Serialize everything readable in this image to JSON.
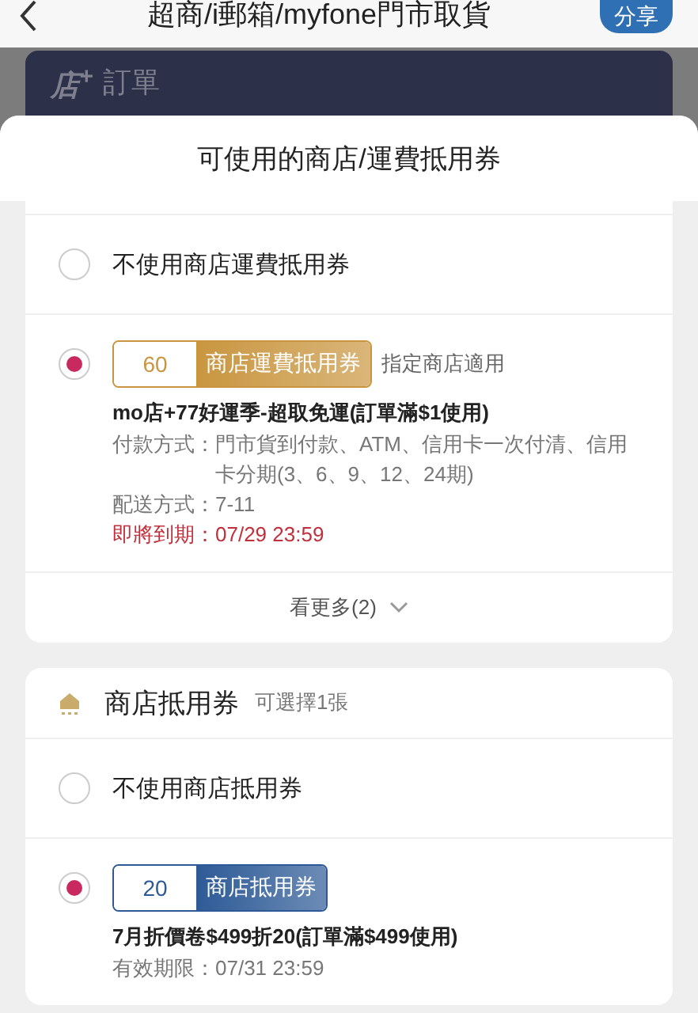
{
  "nav": {
    "title": "超商/i郵箱/myfone門市取貨",
    "share_button": "分享"
  },
  "background_card": {
    "logo": "店$^{+}$",
    "title": "訂單"
  },
  "sheet": {
    "title": "可使用的商店/運費抵用券"
  },
  "sections": [
    {
      "options": [
        {
          "kind": "none",
          "label": "不使用商店運費抵用券",
          "selected": false
        },
        {
          "kind": "coupon",
          "selected": true,
          "amount": "60",
          "type_label": "商店運費抵用券",
          "color": "#c9963f",
          "scope": "指定商店適用",
          "name": "mo店+77好運季-超取免運(訂單滿$1使用)",
          "details": [
            {
              "label": "付款方式：",
              "value": "門市貨到付款、ATM、信用卡一次付清、信用卡分期(3、6、9、12、24期)",
              "urgent": false
            },
            {
              "label": "配送方式：",
              "value": "7-11",
              "urgent": false
            },
            {
              "label": "即將到期：",
              "value": "07/29 23:59",
              "urgent": true
            }
          ]
        }
      ],
      "more": "看更多(2)"
    },
    {
      "header": {
        "title": "商店抵用券",
        "note": "可選擇1張"
      },
      "options": [
        {
          "kind": "none",
          "label": "不使用商店抵用券",
          "selected": false
        },
        {
          "kind": "coupon",
          "selected": true,
          "amount": "20",
          "type_label": "商店抵用券",
          "color": "#2d5a96",
          "name": "7月折價卷$499折20(訂單滿$499使用)",
          "details": [
            {
              "label": "有效期限：",
              "value": "07/31 23:59",
              "urgent": false
            }
          ]
        }
      ]
    }
  ]
}
